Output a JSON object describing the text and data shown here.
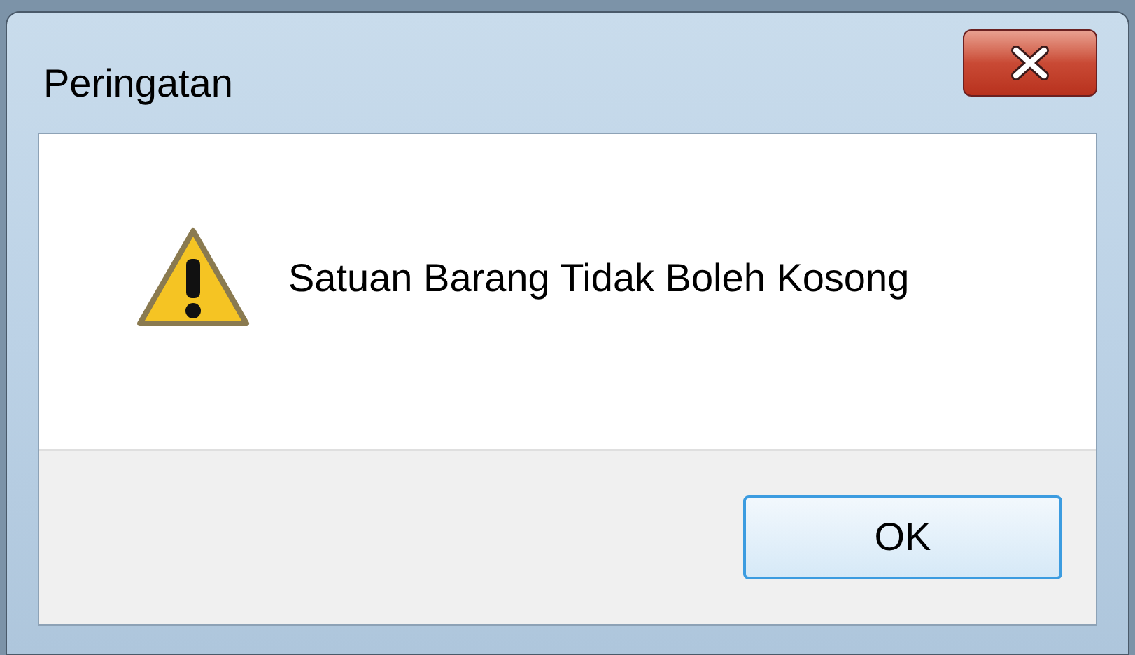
{
  "window": {
    "title": "Peringatan"
  },
  "message": "Satuan Barang Tidak Boleh Kosong",
  "buttons": [
    {
      "label": "OK"
    }
  ]
}
